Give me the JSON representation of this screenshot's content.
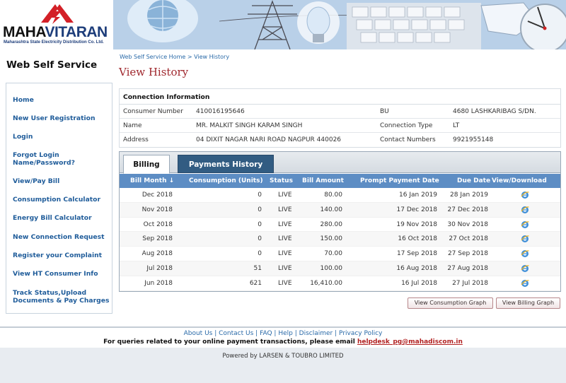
{
  "logo": {
    "brand_left": "MAHA",
    "brand_right": "VITARAN",
    "tagline": "Maharashtra State Electricity Distribution Co. Ltd."
  },
  "site_title": "Web Self Service",
  "sidebar": {
    "items": [
      {
        "label": "Home"
      },
      {
        "label": "New User Registration"
      },
      {
        "label": "Login"
      },
      {
        "label": "Forgot Login Name/Password?"
      },
      {
        "label": "View/Pay Bill"
      },
      {
        "label": "Consumption Calculator"
      },
      {
        "label": "Energy Bill Calculator"
      },
      {
        "label": "New Connection Request"
      },
      {
        "label": "Register your Complaint"
      },
      {
        "label": "View HT Consumer Info"
      },
      {
        "label": "Track Status,Upload Documents & Pay Charges"
      }
    ]
  },
  "breadcrumb": "Web Self Service Home > View History",
  "page_title": "View History",
  "connection": {
    "heading": "Connection Information",
    "rows": [
      {
        "k1": "Consumer Number",
        "v1": "410016195646",
        "k2": "BU",
        "v2": "4680 LASHKARIBAG S/DN."
      },
      {
        "k1": "Name",
        "v1": "MR. MALKIT SINGH KARAM SINGH",
        "k2": "Connection Type",
        "v2": "LT"
      },
      {
        "k1": "Address",
        "v1": "04 DIXIT NAGAR NARI ROAD NAGPUR 440026",
        "k2": "Contact Numbers",
        "v2": "9921955148"
      }
    ]
  },
  "tabs": {
    "billing": "Billing",
    "payments": "Payments History"
  },
  "table": {
    "headers": {
      "bill_month": "Bill Month ↓",
      "consumption": "Consumption (Units)",
      "status": "Status",
      "amount": "Bill Amount",
      "prompt": "Prompt Payment Date",
      "due": "Due Date",
      "view": "View/Download"
    },
    "rows": [
      {
        "month": "Dec 2018",
        "units": "0",
        "status": "LIVE",
        "amount": "80.00",
        "prompt": "16 Jan 2019",
        "due": "28 Jan 2019"
      },
      {
        "month": "Nov 2018",
        "units": "0",
        "status": "LIVE",
        "amount": "140.00",
        "prompt": "17 Dec 2018",
        "due": "27 Dec 2018"
      },
      {
        "month": "Oct 2018",
        "units": "0",
        "status": "LIVE",
        "amount": "280.00",
        "prompt": "19 Nov 2018",
        "due": "30 Nov 2018"
      },
      {
        "month": "Sep 2018",
        "units": "0",
        "status": "LIVE",
        "amount": "150.00",
        "prompt": "16 Oct 2018",
        "due": "27 Oct 2018"
      },
      {
        "month": "Aug 2018",
        "units": "0",
        "status": "LIVE",
        "amount": "70.00",
        "prompt": "17 Sep 2018",
        "due": "27 Sep 2018"
      },
      {
        "month": "Jul 2018",
        "units": "51",
        "status": "LIVE",
        "amount": "100.00",
        "prompt": "16 Aug 2018",
        "due": "27 Aug 2018"
      },
      {
        "month": "Jun 2018",
        "units": "621",
        "status": "LIVE",
        "amount": "16,410.00",
        "prompt": "16 Jul 2018",
        "due": "27 Jul 2018"
      }
    ],
    "view_icon": "ie-icon"
  },
  "buttons": {
    "consumption_graph": "View Consumption Graph",
    "billing_graph": "View Billing Graph"
  },
  "footer": {
    "links": [
      "About Us",
      "Contact Us",
      "FAQ",
      "Help",
      "Disclaimer",
      "Privacy Policy"
    ],
    "query_text": "For queries related to your online payment transactions, please email",
    "email": "helpdesk_pg@mahadiscom.in",
    "powered_by": "Powered by LARSEN & TOUBRO LIMITED"
  },
  "colors": {
    "accent_red": "#a0282e",
    "link_blue": "#1f5c9a",
    "table_header": "#5d8dc4",
    "tab_active_dark": "#325c82"
  }
}
